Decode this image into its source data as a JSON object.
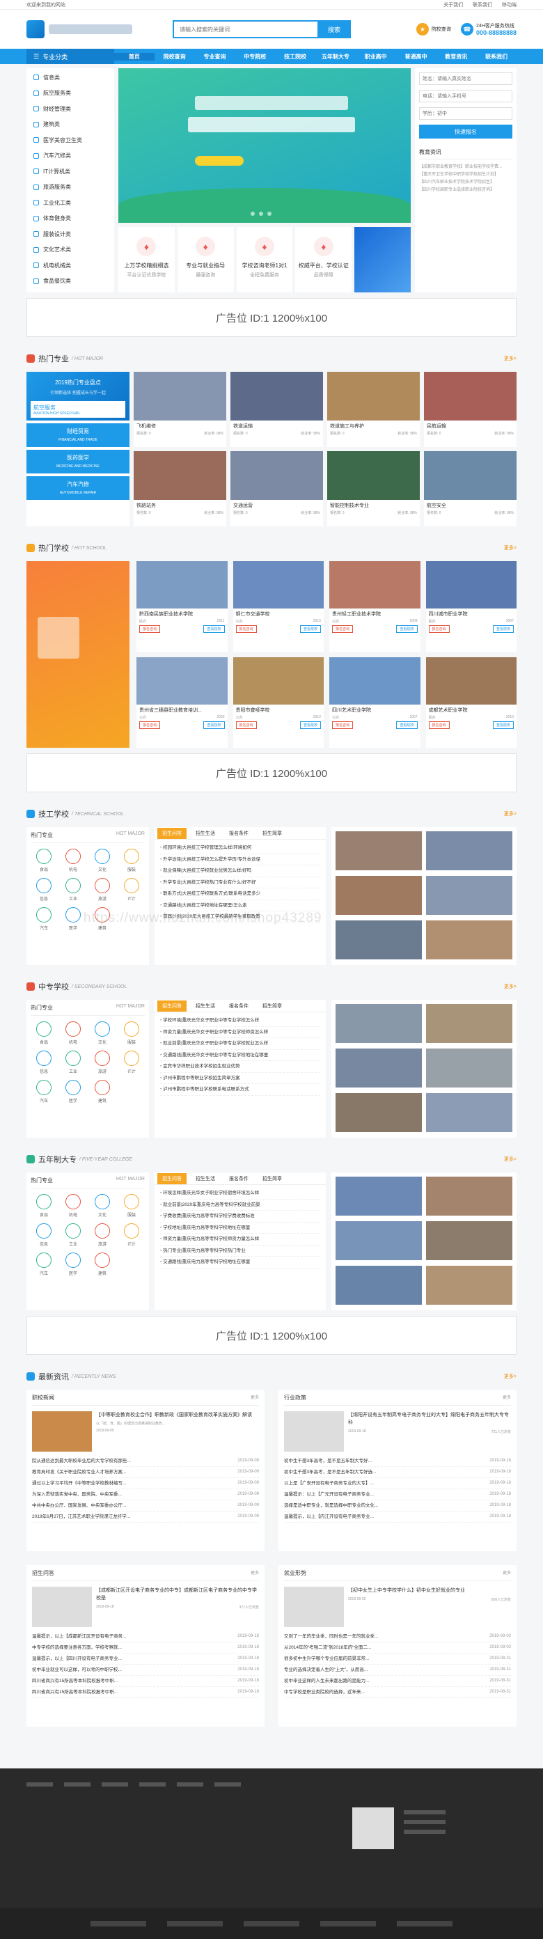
{
  "topbar": {
    "welcome": "欢迎来到我的网站",
    "links": [
      "关于我们",
      "联系我们",
      "移动端"
    ]
  },
  "header": {
    "search_placeholder": "请输入搜索的关键词",
    "search_btn": "搜索",
    "info1_t1": "院校查询",
    "info1_t2": "",
    "info2_t1": "24H客户服务热线",
    "info2_t2": "000-88888888"
  },
  "nav": {
    "cat": "专业分类",
    "items": [
      "首页",
      "院校查询",
      "专业查询",
      "中专院校",
      "技工院校",
      "五年制大专",
      "职业高中",
      "普通高中",
      "教育资讯",
      "联系我们"
    ]
  },
  "sidecat": [
    "信息类",
    "航空服务类",
    "财经管理类",
    "建筑类",
    "医学美容卫生类",
    "汽车汽修类",
    "IT计算机类",
    "旅游服务类",
    "工业化工类",
    "体育健身类",
    "服装设计类",
    "文化艺术类",
    "机电机械类",
    "食品餐饮类"
  ],
  "features": [
    {
      "t1": "上万学校精挑细选",
      "t2": "平台认证优质学校"
    },
    {
      "t1": "专业与就业指导",
      "t2": "最强咨询"
    },
    {
      "t1": "学校咨询老师1对1",
      "t2": "全程免费服务"
    },
    {
      "t1": "权威平台、学校认证",
      "t2": "品质保障"
    }
  ],
  "form": {
    "name_ph": "姓名：请输入真实姓名",
    "phone_ph": "电话：请输入手机号",
    "edu": "学历：初中",
    "submit": "快速报名",
    "news_title": "教育资讯",
    "news": [
      "【成都市职业教育学校】职业技能学校学费...",
      "【重庆市卫生学校中职学校学校招生计划】",
      "【四川汽车职业技术学院技术学院招生】",
      "【四川学校高职专业选择职业院校咨询】"
    ]
  },
  "ad": {
    "text": "广告位 ID:1 1200%x100"
  },
  "sections": {
    "major": {
      "name": "热门专业",
      "en": "/ HOT MAJOR",
      "more": "更多>"
    },
    "school": {
      "name": "热门学校",
      "en": "/ HOT SCHOOL",
      "more": "更多>"
    },
    "tech": {
      "name": "技工学校",
      "en": "/ TECHNICAL SCHOOL",
      "more": "更多>"
    },
    "secondary": {
      "name": "中专学校",
      "en": "/ SECONDARY SCHOOL",
      "more": "更多>"
    },
    "college": {
      "name": "五年制大专",
      "en": "/ FIVE-YEAR COLLEGE",
      "more": "更多>"
    },
    "news": {
      "name": "最新资讯",
      "en": "/ RECENTLY NEWS",
      "more": "更多>"
    }
  },
  "majleft": {
    "a": "2019热门专业盘点",
    "b": "引领新选择 把握成长与学一起",
    "card": "航空服务",
    "card_en": "AVIATION HIGH SPEED RAIL",
    "tabs": [
      {
        "cn": "财经贸易",
        "en": "FINANCIAL AND TRADE"
      },
      {
        "cn": "医药医学",
        "en": "MEDICINE AND MEDICINE"
      },
      {
        "cn": "汽车汽修",
        "en": "AUTOMOBILE REPAIR"
      }
    ]
  },
  "majors": [
    {
      "n": "飞机维修",
      "a": "报名数: 0",
      "b": "就业率: 98%"
    },
    {
      "n": "铁道运输",
      "a": "报名数: 0",
      "b": "就业率: 98%"
    },
    {
      "n": "铁道施工与养护",
      "a": "报名数: 0",
      "b": "就业率: 98%"
    },
    {
      "n": "民航运输",
      "a": "报名数: 0",
      "b": "就业率: 98%"
    },
    {
      "n": "铁路站务",
      "a": "报名数: 0",
      "b": "就业率: 98%"
    },
    {
      "n": "交通运营",
      "a": "报名数: 0",
      "b": "就业率: 98%"
    },
    {
      "n": "智能控制技术专业",
      "a": "报名数: 0",
      "b": "就业率: 98%"
    },
    {
      "n": "航空安全",
      "a": "报名数: 0",
      "b": "就业率: 98%"
    }
  ],
  "schoolsList": [
    {
      "n": "黔西南民族职业技术学院",
      "a": "民办",
      "b": "2011"
    },
    {
      "n": "铜仁市交通学校",
      "a": "公办",
      "b": "2015"
    },
    {
      "n": "贵州轻工职业技术学院",
      "a": "公办",
      "b": "2009"
    },
    {
      "n": "四川城市职业学院",
      "a": "民办",
      "b": "2007"
    },
    {
      "n": "贵州省三穗县职业教育培训...",
      "a": "公办",
      "b": "2003"
    },
    {
      "n": "贵阳市聋哑学校",
      "a": "公办",
      "b": "2012"
    },
    {
      "n": "四川艺术职业学院",
      "a": "公办",
      "b": "2007"
    },
    {
      "n": "成都艺术职业学院",
      "a": "民办",
      "b": "2010"
    }
  ],
  "sg_btn": {
    "a": "报名咨询",
    "b": "查看院校"
  },
  "hot": {
    "title": "热门专业",
    "en": "HOT MAJOR",
    "items": [
      "食品",
      "机电",
      "文化",
      "服装",
      "信息",
      "工业",
      "旅游",
      "IT计",
      "汽车",
      "医学",
      "建筑",
      ""
    ]
  },
  "newsTabs": [
    "招生问答",
    "招生生活",
    "报名条件",
    "招生简章"
  ],
  "techNews": [
    "校园环境|大邑技工学校管理怎么样/环境如何",
    "升学途径|大邑技工学校怎么提升学历/专升本途径",
    "就业保障|大邑技工学校就业优势怎么样/好吗",
    "升学专业|大邑技工学校热门专业有什么/好不好",
    "联系方式|大邑技工学校联系方式/联系电话是多少",
    "交通路线|大邑技工学校地址在哪里/怎么走",
    "首届计划|2020年大邑技工学校最新学生录取政策"
  ],
  "secNews": [
    "学校环境|重庆光华女子职业中等专业学校怎么样",
    "师资力量|重庆光华女子职业中等专业学校师资怎么样",
    "就业前景|重庆光华女子职业中等专业学校就业怎么样",
    "交通路线|重庆光华女子职业中等专业学校地址在哪里",
    "宜宾市华祥职业技术学校招生就业优势",
    "泸州市鹏程中等职业学校招生简章方案",
    "泸州市鹏程中等职业学校联系电话联系方式"
  ],
  "colNews": [
    "环境怎样|重庆光华女子职业学校宿舍环境怎么样",
    "就业前景|2020年重庆电力高等专科学校就业前景",
    "学费收费|重庆电力高等专科学校学费收费标准",
    "学校地址|重庆电力高等专科学校地址在哪里",
    "师资力量|重庆电力高等专科学校师资力量怎么样",
    "热门专业|重庆电力高等专科学校热门专业",
    "交通路线|重庆电力高等专科学校地址在哪里"
  ],
  "latest": [
    {
      "title": "职校新闻",
      "more": "更多",
      "tt": "【中等职业教育校企合作】职教新政《国家职业教育改革实施方案》解读",
      "desc": "以「技、育、服」的理念出发推进职业教育...",
      "date": "2019-09-09",
      "views": "",
      "rows": [
        [
          "院从通信达到最大职校毕业后的大专学校有那些...",
          "2019-09-09"
        ],
        [
          "教育局印发《关于职业院校专业人才培养方案...",
          "2019-09-09"
        ],
        [
          "通过以上学习平均开《中等职业学校教材编写...",
          "2019-09-09"
        ],
        [
          "为深入贯彻落实党中央、国务院、中央军委...",
          "2019-09-09"
        ],
        [
          "中共中央办公厅、国家发展、中央军委办公厅...",
          "2019-09-09"
        ],
        [
          "2019年6月27日，江苏艺术职业学院漯江龙纤学...",
          "2019-09-09"
        ]
      ]
    },
    {
      "title": "行业政策",
      "more": "更多",
      "tt": "【绵阳开设有五年制高专电子商务专业的大专】绵阳电子商务五年制大专专科",
      "desc": "",
      "date": "2019-09-18",
      "views": "721人已浏览",
      "rows": [
        [
          "初中生千想3年高考，是不是五年制大专好...",
          "2019-09-18"
        ],
        [
          "初中生千想3年高考，是不是五年制大专好选...",
          "2019-09-18"
        ],
        [
          "以上是【广安开设有电子商务专业的大专】...",
          "2019-09-18"
        ],
        [
          "温馨提示：以上【广元开设有电子商务专业...",
          "2019-09-18"
        ],
        [
          "选择是适中职专业，就是选择中职专业的文化...",
          "2019-09-18"
        ],
        [
          "温馨提示，以上【内江开设有电子商务专业...",
          "2019-09-18"
        ]
      ]
    },
    {
      "title": "招生问答",
      "more": "更多",
      "tt": "【成都新江区开设电子商务专业的中专】成都新江区电子商务专业的中专学校是",
      "desc": "",
      "date": "2019-09-18",
      "views": "371人已浏览",
      "rows": [
        [
          "温馨提示，以上【成都新江区开设有电子商务...",
          "2019-09-18"
        ],
        [
          "中专学校的选择要注意各方面，学校考察就...",
          "2019-09-18"
        ],
        [
          "温馨提示，以上【四川开设有电子商务专业...",
          "2019-09-18"
        ],
        [
          "初中毕业就业可以这样，可以考的中职学校...",
          "2019-09-18"
        ],
        [
          "四川省商兴有15所高等本科院校报考中职...",
          "2019-09-18"
        ],
        [
          "四川省商兴有15所高等本科院校报考中职...",
          "2019-09-18"
        ]
      ]
    },
    {
      "title": "就业形势",
      "more": "更多",
      "tt": "【初中女生上中专学校学什么】初中女生好就业的专业",
      "desc": "",
      "date": "2019-09-02",
      "views": "558人已浏览",
      "rows": [
        [
          "又到了一年的毕业季，同时也是一年的就业季...",
          "2019-09-02"
        ],
        [
          "从2014年的“考强二流”到2018年的“全面二...",
          "2019-09-02"
        ],
        [
          "很多初中生升学哪个专业应届的前景非常...",
          "2019-08-31"
        ],
        [
          "专业的选择决定着人生的“上大”，从而高...",
          "2019-08-31"
        ],
        [
          "初中毕业这样的人生未来都出路的是能力...",
          "2019-08-31"
        ],
        [
          "中专学校是职业类院校的选择，近年来...",
          "2019-08-31"
        ]
      ]
    }
  ],
  "watermark": "https://www.huzhan.com/ishop43289"
}
